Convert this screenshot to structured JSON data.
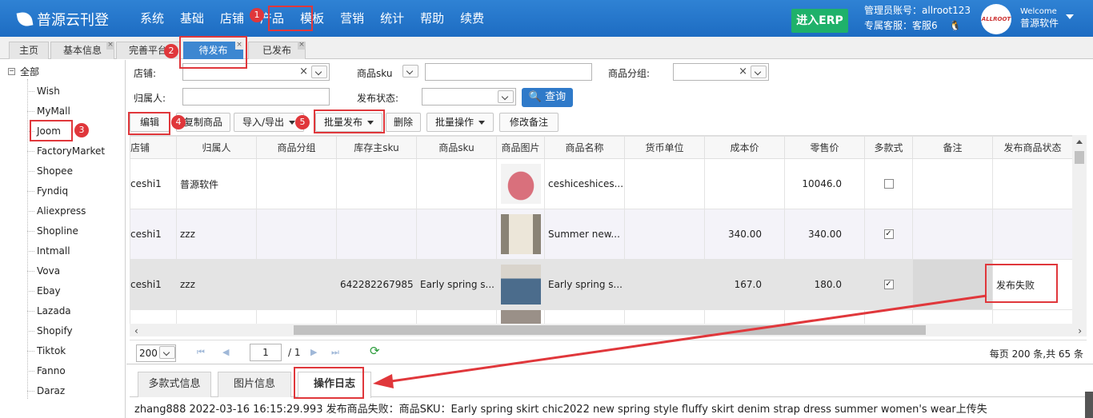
{
  "header": {
    "brand": "普源云刊登",
    "nav": [
      "系统",
      "基础",
      "店铺",
      "产品",
      "模板",
      "营销",
      "统计",
      "帮助",
      "续费"
    ],
    "erp_button": "进入ERP",
    "admin_account": "管理员账号：allroot123",
    "service": "专属客服：客服6",
    "avatar_text": "ALLROOT",
    "welcome": "Welcome",
    "user_name": "普源软件"
  },
  "tabs": [
    {
      "label": "主页"
    },
    {
      "label": "基本信息"
    },
    {
      "label": "完善平台"
    },
    {
      "label": "待发布"
    },
    {
      "label": "已发布"
    }
  ],
  "tab_close": "×",
  "sidebar": {
    "root": "全部",
    "items": [
      "Wish",
      "MyMall",
      "Joom",
      "FactoryMarket",
      "Shopee",
      "Fyndiq",
      "Aliexpress",
      "Shopline",
      "Intmall",
      "Vova",
      "Ebay",
      "Lazada",
      "Shopify",
      "Tiktok",
      "Fanno",
      "Daraz"
    ]
  },
  "filters": {
    "shop_label": "店铺:",
    "sku_label": "商品sku",
    "group_label": "商品分组:",
    "owner_label": "归属人:",
    "status_label": "发布状态:",
    "query_button": "查询"
  },
  "toolbar": {
    "edit": "编辑",
    "copy": "复制商品",
    "import_export": "导入/导出",
    "batch_publish": "批量发布",
    "delete": "删除",
    "batch_ops": "批量操作",
    "modify_remark": "修改备注"
  },
  "table": {
    "columns": [
      "店铺",
      "归属人",
      "商品分组",
      "库存主sku",
      "商品sku",
      "商品图片",
      "商品名称",
      "货币单位",
      "成本价",
      "零售价",
      "多款式",
      "备注",
      "发布商品状态"
    ],
    "rows": [
      {
        "shop": "ceshi1",
        "owner": "普源软件",
        "group": "",
        "main_sku": "",
        "sku": "",
        "name": "ceshiceshices...",
        "currency": "",
        "cost": "",
        "retail": "10046.0",
        "multi": false,
        "remark": "",
        "status": ""
      },
      {
        "shop": "ceshi1",
        "owner": "zzz",
        "group": "",
        "main_sku": "",
        "sku": "",
        "name": "Summer new...",
        "currency": "",
        "cost": "340.00",
        "retail": "340.00",
        "multi": true,
        "remark": "",
        "status": ""
      },
      {
        "shop": "ceshi1",
        "owner": "zzz",
        "group": "",
        "main_sku": "642282267985",
        "sku": "Early spring s...",
        "name": "Early spring s...",
        "currency": "",
        "cost": "167.0",
        "retail": "180.0",
        "multi": true,
        "remark": "",
        "status": "发布失败"
      }
    ]
  },
  "pager": {
    "page_size": "200",
    "page": "1",
    "total_pages": "/ 1",
    "info": "每页 200 条,共 65 条"
  },
  "bottom_tabs": [
    "多款式信息",
    "图片信息",
    "操作日志"
  ],
  "log_text": "zhang888 2022-03-16 16:15:29.993 发布商品失败：商品SKU：Early spring skirt chic2022 new spring style fluffy skirt denim strap dress summer women's wear上传失",
  "badges": [
    "1",
    "2",
    "3",
    "4",
    "5"
  ],
  "colors": {
    "header": "#2272c8",
    "accent": "#3d87d1",
    "erp": "#1fb16a",
    "highlight": "#e0373b"
  }
}
